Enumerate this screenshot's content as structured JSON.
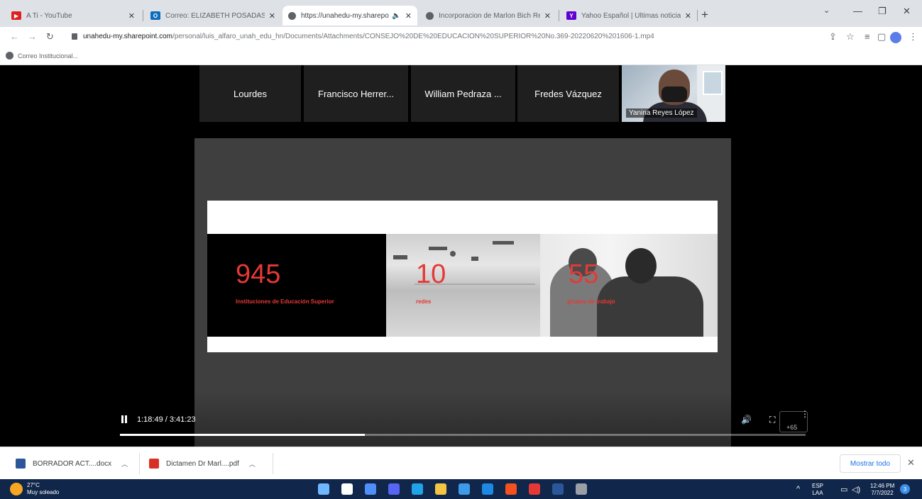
{
  "browser": {
    "tabs": [
      {
        "title": "A Ti - YouTube",
        "favicon_color": "#e02020",
        "favicon_glyph": "▶",
        "active": false
      },
      {
        "title": "Correo: ELIZABETH POSADAS CE",
        "favicon_color": "#0f6cbd",
        "favicon_glyph": "O",
        "active": false
      },
      {
        "title": "https://unahedu-my.sharepo",
        "favicon_color": "#5f6368",
        "favicon_glyph": "",
        "active": true,
        "has_sound": true
      },
      {
        "title": "Incorporacion de Marlon Bich Re",
        "favicon_color": "#5f6368",
        "favicon_glyph": "",
        "active": false
      },
      {
        "title": "Yahoo Español | Últimas noticias",
        "favicon_color": "#6001d2",
        "favicon_glyph": "Y",
        "active": false
      }
    ],
    "url_host": "unahedu-my.sharepoint.com",
    "url_path": "/personal/luis_alfaro_unah_edu_hn/Documents/Attachments/CONSEJO%20DE%20EDUCACIÓN%20SUPERIOR%20No.369-20220620%201606-1.mp4",
    "bookmark": "Correo Institucional..."
  },
  "meeting": {
    "participants": [
      "Lourdes",
      "Francisco Herrer...",
      "William Pedraza ...",
      "Fredes Vázquez"
    ],
    "camera_name": "Yanina Reyes López"
  },
  "slide": {
    "stats": [
      {
        "number": "945",
        "label": "Instituciones de Educación Superior"
      },
      {
        "number": "10",
        "label": "redes"
      },
      {
        "number": "55",
        "label": "grupos de trabajo"
      }
    ]
  },
  "player": {
    "timecode": "1:18:49 / 3:41:23",
    "progress": 0.357,
    "extra_count": "+65"
  },
  "downloads": {
    "items": [
      {
        "name": "BORRADOR ACT....docx",
        "color": "#2b579a"
      },
      {
        "name": "Dictamen Dr Marl....pdf",
        "color": "#d93025"
      }
    ],
    "show_all": "Mostrar todo"
  },
  "taskbar": {
    "temp": "27°C",
    "weather": "Muy soleado",
    "lang_top": "ESP",
    "lang_bottom": "LAA",
    "time": "12:46 PM",
    "date": "7/7/2022",
    "notifications": "3",
    "apps": [
      "#6fb7ff",
      "#ffffff",
      "#4f8ff7",
      "#5865f2",
      "#1fa3e8",
      "#f5c542",
      "#3c9be8",
      "#1e88e5",
      "#f4511e",
      "#e53935",
      "#2b579a",
      "#9aa0a6"
    ]
  }
}
